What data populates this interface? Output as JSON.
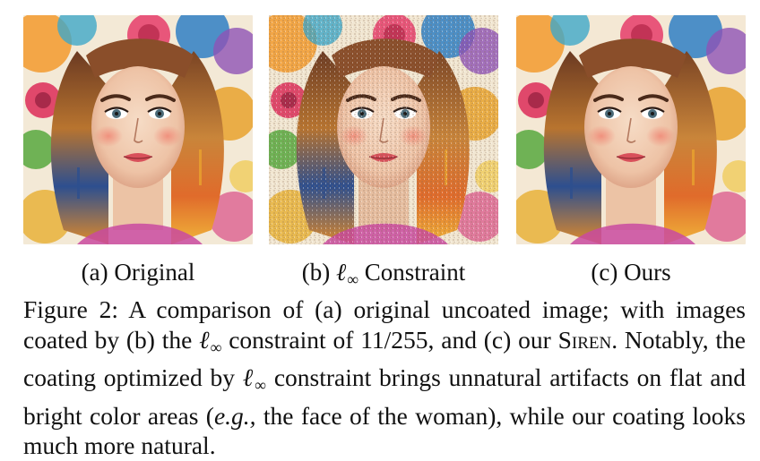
{
  "figure": {
    "panels": [
      {
        "id": "a",
        "label": "(a) Original",
        "variant": "original"
      },
      {
        "id": "b",
        "label_prefix": "(b)",
        "label_symbol": "ℓ",
        "label_subscript": "∞",
        "label_suffix": "Constraint",
        "variant": "linf-coated"
      },
      {
        "id": "c",
        "label": "(c) Ours",
        "variant": "siren-coated"
      }
    ],
    "caption": {
      "prefix": "Figure 2:",
      "part1": "A comparison of (a) original uncoated image; with images coated by (b) the",
      "symbol": "ℓ",
      "subscript": "∞",
      "part2": "constraint of 11/255, and (c) our",
      "method_name": "Siren",
      "part3": ". Notably, the coating optimized by",
      "part4": "constraint brings unnatural artifacts on flat and bright color areas (",
      "eg": "e.g.,",
      "part5": "the face of the woman), while our coating looks much more natural."
    }
  }
}
